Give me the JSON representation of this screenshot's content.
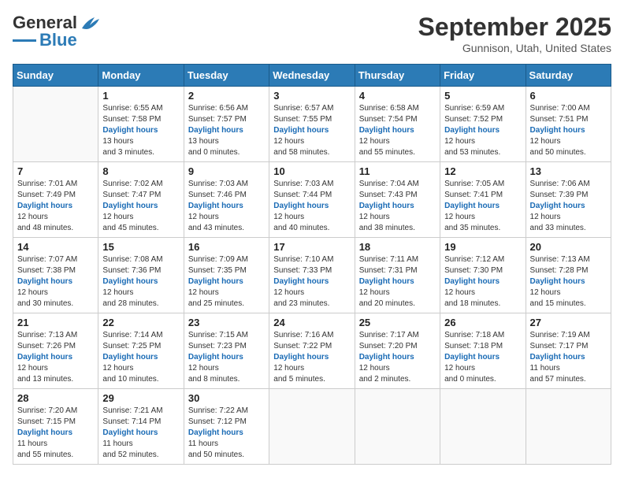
{
  "header": {
    "logo_line1": "General",
    "logo_line2": "Blue",
    "month": "September 2025",
    "location": "Gunnison, Utah, United States"
  },
  "weekdays": [
    "Sunday",
    "Monday",
    "Tuesday",
    "Wednesday",
    "Thursday",
    "Friday",
    "Saturday"
  ],
  "weeks": [
    [
      {
        "day": "",
        "sunrise": "",
        "sunset": "",
        "daylight": ""
      },
      {
        "day": "1",
        "sunrise": "Sunrise: 6:55 AM",
        "sunset": "Sunset: 7:58 PM",
        "daylight": "Daylight: 13 hours and 3 minutes."
      },
      {
        "day": "2",
        "sunrise": "Sunrise: 6:56 AM",
        "sunset": "Sunset: 7:57 PM",
        "daylight": "Daylight: 13 hours and 0 minutes."
      },
      {
        "day": "3",
        "sunrise": "Sunrise: 6:57 AM",
        "sunset": "Sunset: 7:55 PM",
        "daylight": "Daylight: 12 hours and 58 minutes."
      },
      {
        "day": "4",
        "sunrise": "Sunrise: 6:58 AM",
        "sunset": "Sunset: 7:54 PM",
        "daylight": "Daylight: 12 hours and 55 minutes."
      },
      {
        "day": "5",
        "sunrise": "Sunrise: 6:59 AM",
        "sunset": "Sunset: 7:52 PM",
        "daylight": "Daylight: 12 hours and 53 minutes."
      },
      {
        "day": "6",
        "sunrise": "Sunrise: 7:00 AM",
        "sunset": "Sunset: 7:51 PM",
        "daylight": "Daylight: 12 hours and 50 minutes."
      }
    ],
    [
      {
        "day": "7",
        "sunrise": "Sunrise: 7:01 AM",
        "sunset": "Sunset: 7:49 PM",
        "daylight": "Daylight: 12 hours and 48 minutes."
      },
      {
        "day": "8",
        "sunrise": "Sunrise: 7:02 AM",
        "sunset": "Sunset: 7:47 PM",
        "daylight": "Daylight: 12 hours and 45 minutes."
      },
      {
        "day": "9",
        "sunrise": "Sunrise: 7:03 AM",
        "sunset": "Sunset: 7:46 PM",
        "daylight": "Daylight: 12 hours and 43 minutes."
      },
      {
        "day": "10",
        "sunrise": "Sunrise: 7:03 AM",
        "sunset": "Sunset: 7:44 PM",
        "daylight": "Daylight: 12 hours and 40 minutes."
      },
      {
        "day": "11",
        "sunrise": "Sunrise: 7:04 AM",
        "sunset": "Sunset: 7:43 PM",
        "daylight": "Daylight: 12 hours and 38 minutes."
      },
      {
        "day": "12",
        "sunrise": "Sunrise: 7:05 AM",
        "sunset": "Sunset: 7:41 PM",
        "daylight": "Daylight: 12 hours and 35 minutes."
      },
      {
        "day": "13",
        "sunrise": "Sunrise: 7:06 AM",
        "sunset": "Sunset: 7:39 PM",
        "daylight": "Daylight: 12 hours and 33 minutes."
      }
    ],
    [
      {
        "day": "14",
        "sunrise": "Sunrise: 7:07 AM",
        "sunset": "Sunset: 7:38 PM",
        "daylight": "Daylight: 12 hours and 30 minutes."
      },
      {
        "day": "15",
        "sunrise": "Sunrise: 7:08 AM",
        "sunset": "Sunset: 7:36 PM",
        "daylight": "Daylight: 12 hours and 28 minutes."
      },
      {
        "day": "16",
        "sunrise": "Sunrise: 7:09 AM",
        "sunset": "Sunset: 7:35 PM",
        "daylight": "Daylight: 12 hours and 25 minutes."
      },
      {
        "day": "17",
        "sunrise": "Sunrise: 7:10 AM",
        "sunset": "Sunset: 7:33 PM",
        "daylight": "Daylight: 12 hours and 23 minutes."
      },
      {
        "day": "18",
        "sunrise": "Sunrise: 7:11 AM",
        "sunset": "Sunset: 7:31 PM",
        "daylight": "Daylight: 12 hours and 20 minutes."
      },
      {
        "day": "19",
        "sunrise": "Sunrise: 7:12 AM",
        "sunset": "Sunset: 7:30 PM",
        "daylight": "Daylight: 12 hours and 18 minutes."
      },
      {
        "day": "20",
        "sunrise": "Sunrise: 7:13 AM",
        "sunset": "Sunset: 7:28 PM",
        "daylight": "Daylight: 12 hours and 15 minutes."
      }
    ],
    [
      {
        "day": "21",
        "sunrise": "Sunrise: 7:13 AM",
        "sunset": "Sunset: 7:26 PM",
        "daylight": "Daylight: 12 hours and 13 minutes."
      },
      {
        "day": "22",
        "sunrise": "Sunrise: 7:14 AM",
        "sunset": "Sunset: 7:25 PM",
        "daylight": "Daylight: 12 hours and 10 minutes."
      },
      {
        "day": "23",
        "sunrise": "Sunrise: 7:15 AM",
        "sunset": "Sunset: 7:23 PM",
        "daylight": "Daylight: 12 hours and 8 minutes."
      },
      {
        "day": "24",
        "sunrise": "Sunrise: 7:16 AM",
        "sunset": "Sunset: 7:22 PM",
        "daylight": "Daylight: 12 hours and 5 minutes."
      },
      {
        "day": "25",
        "sunrise": "Sunrise: 7:17 AM",
        "sunset": "Sunset: 7:20 PM",
        "daylight": "Daylight: 12 hours and 2 minutes."
      },
      {
        "day": "26",
        "sunrise": "Sunrise: 7:18 AM",
        "sunset": "Sunset: 7:18 PM",
        "daylight": "Daylight: 12 hours and 0 minutes."
      },
      {
        "day": "27",
        "sunrise": "Sunrise: 7:19 AM",
        "sunset": "Sunset: 7:17 PM",
        "daylight": "Daylight: 11 hours and 57 minutes."
      }
    ],
    [
      {
        "day": "28",
        "sunrise": "Sunrise: 7:20 AM",
        "sunset": "Sunset: 7:15 PM",
        "daylight": "Daylight: 11 hours and 55 minutes."
      },
      {
        "day": "29",
        "sunrise": "Sunrise: 7:21 AM",
        "sunset": "Sunset: 7:14 PM",
        "daylight": "Daylight: 11 hours and 52 minutes."
      },
      {
        "day": "30",
        "sunrise": "Sunrise: 7:22 AM",
        "sunset": "Sunset: 7:12 PM",
        "daylight": "Daylight: 11 hours and 50 minutes."
      },
      {
        "day": "",
        "sunrise": "",
        "sunset": "",
        "daylight": ""
      },
      {
        "day": "",
        "sunrise": "",
        "sunset": "",
        "daylight": ""
      },
      {
        "day": "",
        "sunrise": "",
        "sunset": "",
        "daylight": ""
      },
      {
        "day": "",
        "sunrise": "",
        "sunset": "",
        "daylight": ""
      }
    ]
  ]
}
